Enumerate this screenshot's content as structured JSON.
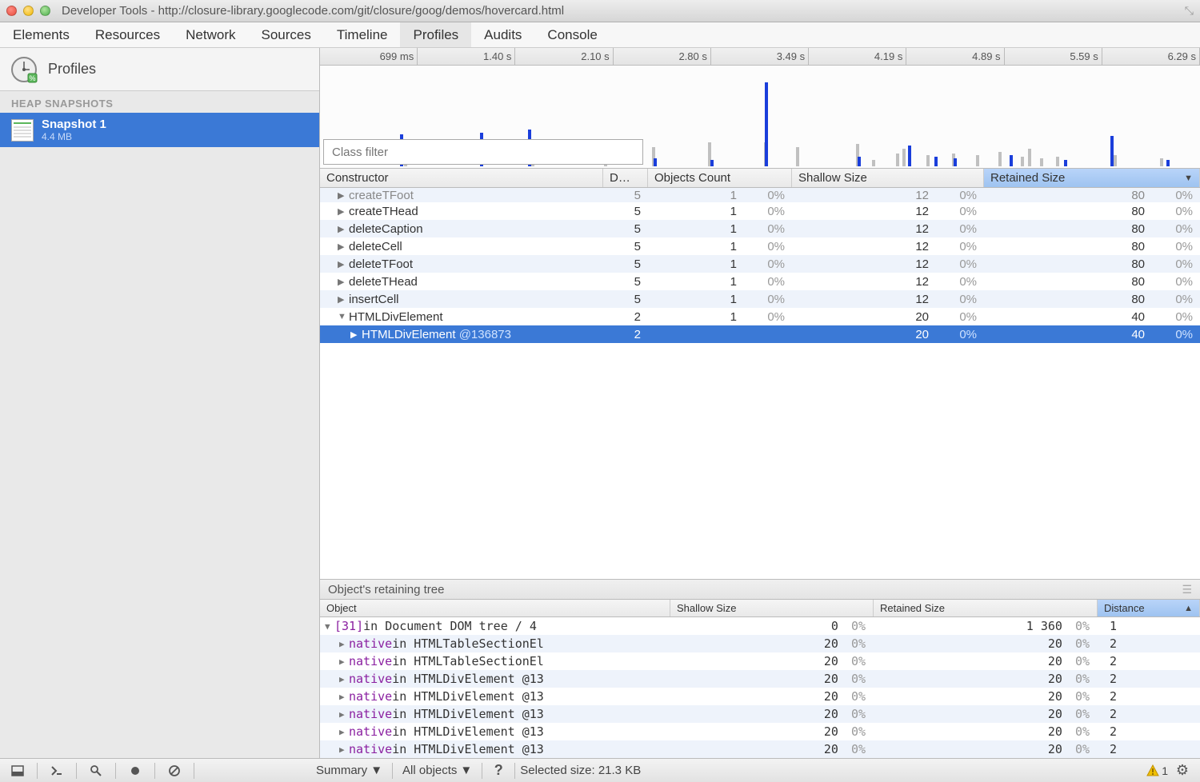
{
  "window": {
    "title": "Developer Tools - http://closure-library.googlecode.com/git/closure/goog/demos/hovercard.html"
  },
  "tabs": [
    "Elements",
    "Resources",
    "Network",
    "Sources",
    "Timeline",
    "Profiles",
    "Audits",
    "Console"
  ],
  "active_tab": "Profiles",
  "sidebar": {
    "title": "Profiles",
    "section": "HEAP SNAPSHOTS",
    "item": {
      "name": "Snapshot 1",
      "size": "4.4 MB"
    }
  },
  "timeline": {
    "ticks": [
      "699 ms",
      "1.40 s",
      "2.10 s",
      "2.80 s",
      "3.49 s",
      "4.19 s",
      "4.89 s",
      "5.59 s",
      "6.29 s"
    ]
  },
  "filter_placeholder": "Class filter",
  "cheaders": [
    "Constructor",
    "D…",
    "Objects Count",
    "Shallow Size",
    "Retained Size"
  ],
  "crows": [
    {
      "name": "createTFoot",
      "d": "5",
      "oc": "1",
      "ocp": "0%",
      "ss": "12",
      "ssp": "0%",
      "rs": "80",
      "rsp": "0%",
      "indent": 1,
      "exp": "closed",
      "partial": true
    },
    {
      "name": "createTHead",
      "d": "5",
      "oc": "1",
      "ocp": "0%",
      "ss": "12",
      "ssp": "0%",
      "rs": "80",
      "rsp": "0%",
      "indent": 1,
      "exp": "closed"
    },
    {
      "name": "deleteCaption",
      "d": "5",
      "oc": "1",
      "ocp": "0%",
      "ss": "12",
      "ssp": "0%",
      "rs": "80",
      "rsp": "0%",
      "indent": 1,
      "exp": "closed"
    },
    {
      "name": "deleteCell",
      "d": "5",
      "oc": "1",
      "ocp": "0%",
      "ss": "12",
      "ssp": "0%",
      "rs": "80",
      "rsp": "0%",
      "indent": 1,
      "exp": "closed"
    },
    {
      "name": "deleteTFoot",
      "d": "5",
      "oc": "1",
      "ocp": "0%",
      "ss": "12",
      "ssp": "0%",
      "rs": "80",
      "rsp": "0%",
      "indent": 1,
      "exp": "closed"
    },
    {
      "name": "deleteTHead",
      "d": "5",
      "oc": "1",
      "ocp": "0%",
      "ss": "12",
      "ssp": "0%",
      "rs": "80",
      "rsp": "0%",
      "indent": 1,
      "exp": "closed"
    },
    {
      "name": "insertCell",
      "d": "5",
      "oc": "1",
      "ocp": "0%",
      "ss": "12",
      "ssp": "0%",
      "rs": "80",
      "rsp": "0%",
      "indent": 1,
      "exp": "closed"
    },
    {
      "name": "HTMLDivElement",
      "d": "2",
      "oc": "1",
      "ocp": "0%",
      "ss": "20",
      "ssp": "0%",
      "rs": "40",
      "rsp": "0%",
      "indent": 1,
      "exp": "open"
    },
    {
      "name": "HTMLDivElement",
      "at": " @136873",
      "d": "2",
      "oc": "",
      "ocp": "",
      "ss": "20",
      "ssp": "0%",
      "rs": "40",
      "rsp": "0%",
      "indent": 2,
      "exp": "closed",
      "sel": true
    }
  ],
  "ret_title": "Object's retaining tree",
  "rheaders": [
    "Object",
    "Shallow Size",
    "Retained Size",
    "Distance"
  ],
  "rrows": [
    {
      "idx": "[31]",
      "txt": " in Document DOM tree / 4",
      "ss": "0",
      "ssp": "0%",
      "rs": "1 360",
      "rsp": "0%",
      "dist": "1",
      "indent": 0,
      "exp": "open"
    },
    {
      "idx": "",
      "nat": "native",
      "txt": " in HTMLTableSectionEl",
      "ss": "20",
      "ssp": "0%",
      "rs": "20",
      "rsp": "0%",
      "dist": "2",
      "indent": 1,
      "exp": "closed"
    },
    {
      "idx": "",
      "nat": "native",
      "txt": " in HTMLTableSectionEl",
      "ss": "20",
      "ssp": "0%",
      "rs": "20",
      "rsp": "0%",
      "dist": "2",
      "indent": 1,
      "exp": "closed"
    },
    {
      "idx": "",
      "nat": "native",
      "txt": " in HTMLDivElement @13",
      "ss": "20",
      "ssp": "0%",
      "rs": "20",
      "rsp": "0%",
      "dist": "2",
      "indent": 1,
      "exp": "closed"
    },
    {
      "idx": "",
      "nat": "native",
      "txt": " in HTMLDivElement @13",
      "ss": "20",
      "ssp": "0%",
      "rs": "20",
      "rsp": "0%",
      "dist": "2",
      "indent": 1,
      "exp": "closed"
    },
    {
      "idx": "",
      "nat": "native",
      "txt": " in HTMLDivElement @13",
      "ss": "20",
      "ssp": "0%",
      "rs": "20",
      "rsp": "0%",
      "dist": "2",
      "indent": 1,
      "exp": "closed"
    },
    {
      "idx": "",
      "nat": "native",
      "txt": " in HTMLDivElement @13",
      "ss": "20",
      "ssp": "0%",
      "rs": "20",
      "rsp": "0%",
      "dist": "2",
      "indent": 1,
      "exp": "closed"
    },
    {
      "idx": "",
      "nat": "native",
      "txt": " in HTMLDivElement @13",
      "ss": "20",
      "ssp": "0%",
      "rs": "20",
      "rsp": "0%",
      "dist": "2",
      "indent": 1,
      "exp": "closed"
    }
  ],
  "status": {
    "view": "Summary",
    "scope": "All objects",
    "selected": "Selected size: 21.3 KB",
    "warn_count": "1"
  }
}
